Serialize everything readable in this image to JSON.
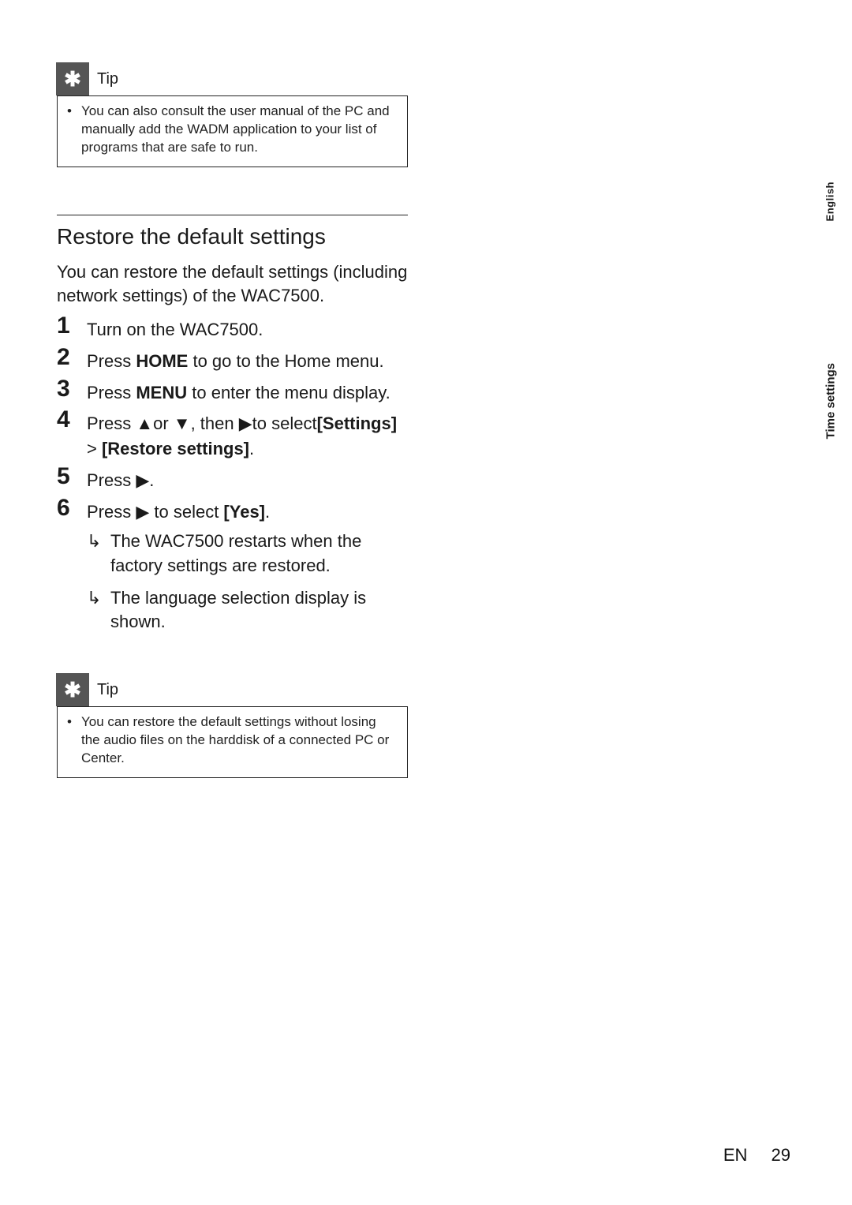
{
  "side": {
    "lang_label": "English",
    "chapter_label": "Time settings"
  },
  "tip1": {
    "label": "Tip",
    "bullet_text": "You can also consult the user manual of the PC and manually add the WADM application to your list of programs that are safe to run."
  },
  "section": {
    "heading": "Restore the default settings",
    "intro": "You can restore the default settings (including network settings) of the WAC7500."
  },
  "steps": {
    "s1": {
      "num": "1",
      "text": "Turn on the WAC7500."
    },
    "s2": {
      "num": "2",
      "pre": "Press ",
      "bold": "HOME",
      "post": " to go to the Home menu."
    },
    "s3": {
      "num": "3",
      "pre": "Press ",
      "bold": "MENU",
      "post": " to enter the menu display."
    },
    "s4": {
      "num": "4",
      "pre": "Press ▲or ▼, then ▶to select",
      "bold1": "[Settings]",
      "mid": " > ",
      "bold2": "[Restore settings]",
      "post": "."
    },
    "s5": {
      "num": "5",
      "text": "Press ▶."
    },
    "s6": {
      "num": "6",
      "pre": "Press ▶ to select ",
      "bold": "[Yes]",
      "post": ".",
      "result1": "The WAC7500 restarts when the factory settings are restored.",
      "result2": "The language selection display is shown."
    }
  },
  "tip2": {
    "label": "Tip",
    "bullet_text": "You can restore the default settings without losing the audio files on the harddisk of a connected PC or Center."
  },
  "footer": {
    "lang_code": "EN",
    "page_num": "29"
  }
}
